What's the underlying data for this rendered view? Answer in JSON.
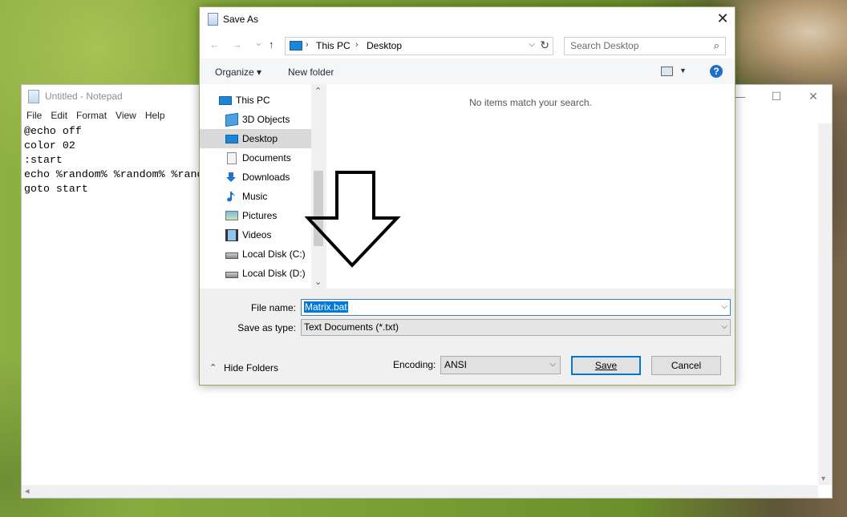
{
  "notepad": {
    "title": "Untitled - Notepad",
    "menu": [
      "File",
      "Edit",
      "Format",
      "View",
      "Help"
    ],
    "lines": [
      "@echo off",
      "color 02",
      ":start",
      "echo %random% %random% %rand",
      "goto start"
    ],
    "controls": {
      "minimize": "—",
      "maximize": "☐",
      "close": "✕"
    }
  },
  "dialog": {
    "title": "Save As",
    "close": "✕",
    "nav": {
      "back": "←",
      "forward": "→",
      "recent": "⌄",
      "up": "↑"
    },
    "address": {
      "segments": [
        "This PC",
        "Desktop"
      ],
      "separator": "›"
    },
    "search_placeholder": "Search Desktop",
    "toolbar": {
      "organize": "Organize ▾",
      "new_folder": "New folder",
      "help": "?"
    },
    "tree": [
      {
        "label": "This PC",
        "icon": "computer-icon"
      },
      {
        "label": "3D Objects",
        "icon": "cube-icon"
      },
      {
        "label": "Desktop",
        "icon": "desktop-icon",
        "selected": true
      },
      {
        "label": "Documents",
        "icon": "document-icon"
      },
      {
        "label": "Downloads",
        "icon": "download-icon"
      },
      {
        "label": "Music",
        "icon": "music-note-icon"
      },
      {
        "label": "Pictures",
        "icon": "picture-icon"
      },
      {
        "label": "Videos",
        "icon": "film-icon"
      },
      {
        "label": "Local Disk (C:)",
        "icon": "drive-icon"
      },
      {
        "label": "Local Disk (D:)",
        "icon": "drive-icon"
      }
    ],
    "empty_message": "No items match your search.",
    "file_name_label": "File name:",
    "file_name_value": "Matrix.bat",
    "save_type_label": "Save as type:",
    "save_type_value": "Text Documents (*.txt)",
    "hide_folders": "Hide Folders",
    "encoding_label": "Encoding:",
    "encoding_value": "ANSI",
    "save_button": "Save",
    "cancel_button": "Cancel"
  }
}
